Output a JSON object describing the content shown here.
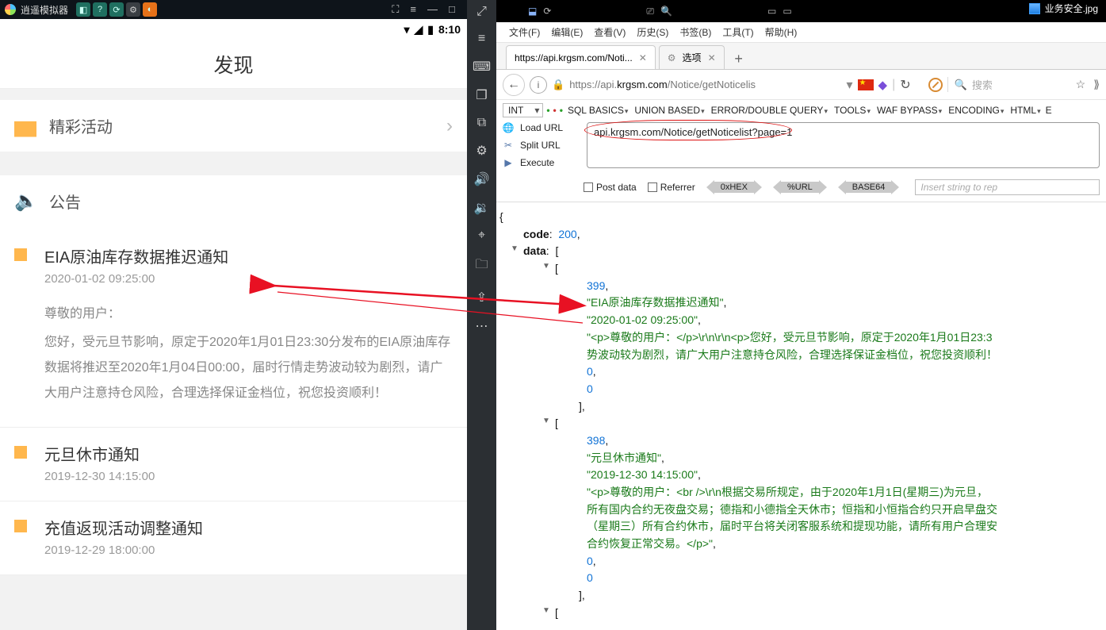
{
  "emulator": {
    "title": "逍遥模拟器",
    "tray_icons": [
      "camera",
      "help",
      "sync",
      "gear",
      "user"
    ],
    "window_buttons": [
      "fullscreen",
      "menu",
      "min",
      "max",
      "close",
      "more"
    ],
    "status": {
      "time": "8:10"
    },
    "app_title": "发现",
    "menu": {
      "activities": {
        "label": "精彩活动"
      },
      "notice_header": {
        "label": "公告"
      }
    },
    "notices": [
      {
        "title": "EIA原油库存数据推迟通知",
        "time": "2020-01-02 09:25:00",
        "body_lead": "尊敬的用户：",
        "body": "您好，受元旦节影响，原定于2020年1月01日23:30分发布的EIA原油库存数据将推迟至2020年1月04日00:00，届时行情走势波动较为剧烈，请广大用户注意持仓风险，合理选择保证金档位，祝您投资顺利！"
      },
      {
        "title": "元旦休市通知",
        "time": "2019-12-30 14:15:00"
      },
      {
        "title": "充值返现活动调整通知",
        "time": "2019-12-29 18:00:00"
      }
    ],
    "sidebar_tools": [
      "expand",
      "menu2",
      "keyboard",
      "copy",
      "window",
      "gear2",
      "vol-up",
      "vol-down",
      "location",
      "folder",
      "share",
      "more2"
    ]
  },
  "browser": {
    "file_item": "业务安全.jpg",
    "menubar": [
      "文件(F)",
      "编辑(E)",
      "查看(V)",
      "历史(S)",
      "书签(B)",
      "工具(T)",
      "帮助(H)"
    ],
    "tabs": [
      {
        "label": "https://api.krgsm.com/Noti...",
        "active": true
      },
      {
        "label": "选项",
        "active": false
      }
    ],
    "url_display_pre": "https://api.",
    "url_display_bold": "krgsm.com",
    "url_display_post": "/Notice/getNoticelis",
    "search_placeholder": "搜索",
    "hackbar": {
      "encoding_sel": "INT",
      "menus": [
        "SQL BASICS",
        "UNION BASED",
        "ERROR/DOUBLE QUERY",
        "TOOLS",
        "WAF BYPASS",
        "ENCODING",
        "HTML",
        "E"
      ],
      "actions": {
        "load": "Load URL",
        "split": "Split URL",
        "execute": "Execute"
      },
      "url_value": "api.krgsm.com/Notice/getNoticelist?page=1",
      "checks": {
        "post": "Post data",
        "ref": "Referrer"
      },
      "chips": [
        "0xHEX",
        "%URL",
        "BASE64"
      ],
      "insert_ph": "Insert string to rep"
    },
    "json": {
      "code": 200,
      "data": [
        {
          "id": 399,
          "title": "EIA原油库存数据推迟通知",
          "time": "2020-01-02 09:25:00",
          "html": "<p>尊敬的用户：</p>\\r\\n\\r\\n<p>您好，受元旦节影响，原定于2020年1月01日23:3势波动较为剧烈，请广大用户注意持仓风险，合理选择保证金档位，祝您投资顺利！",
          "a": 0,
          "b": 0
        },
        {
          "id": 398,
          "title": "元旦休市通知",
          "time": "2019-12-30 14:15:00",
          "html": "<p>尊敬的用户：<br />\\r\\n根据交易所规定，由于2020年1月1日(星期三)为元旦，所有国内合约无夜盘交易；德指和小德指全天休市；恒指和小恒指合约只开启早盘交（星期三）所有合约休市，届时平台将关闭客服系统和提现功能，请所有用户合理安合约恢复正常交易。</p>",
          "a": 0,
          "b": 0
        }
      ]
    }
  }
}
